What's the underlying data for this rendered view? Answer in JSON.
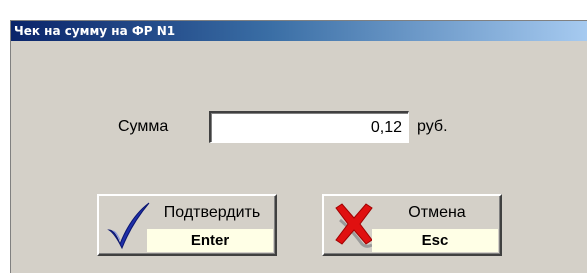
{
  "window": {
    "title": "Чек на сумму на ФР N1"
  },
  "form": {
    "sum_label": "Сумма",
    "sum_value": "0,12",
    "currency": "руб."
  },
  "buttons": {
    "confirm": {
      "label": "Подтвердить",
      "key": "Enter",
      "icon": "checkmark-icon",
      "color": "#1f2fa8"
    },
    "cancel": {
      "label": "Отмена",
      "key": "Esc",
      "icon": "cross-icon",
      "color": "#e01010"
    }
  }
}
